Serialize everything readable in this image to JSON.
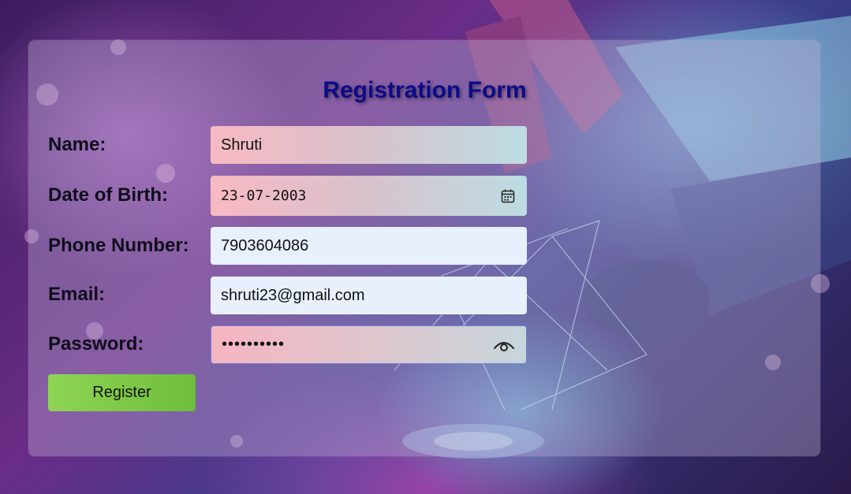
{
  "form": {
    "title": "Registration Form",
    "name": {
      "label": "Name:",
      "value": "Shruti"
    },
    "dob": {
      "label": "Date of Birth:",
      "value": "23-07-2003"
    },
    "phone": {
      "label": "Phone Number:",
      "value": "7903604086"
    },
    "email": {
      "label": "Email:",
      "value": "shruti23@gmail.com"
    },
    "password": {
      "label": "Password:",
      "value": "••••••••••"
    },
    "register_label": "Register"
  },
  "icons": {
    "dob_picker": "calendar-icon",
    "password_toggle": "eye-icon"
  },
  "colors": {
    "title": "#0b0b8a",
    "button": "#7ac846",
    "input_plain": "#e8f0fd"
  }
}
